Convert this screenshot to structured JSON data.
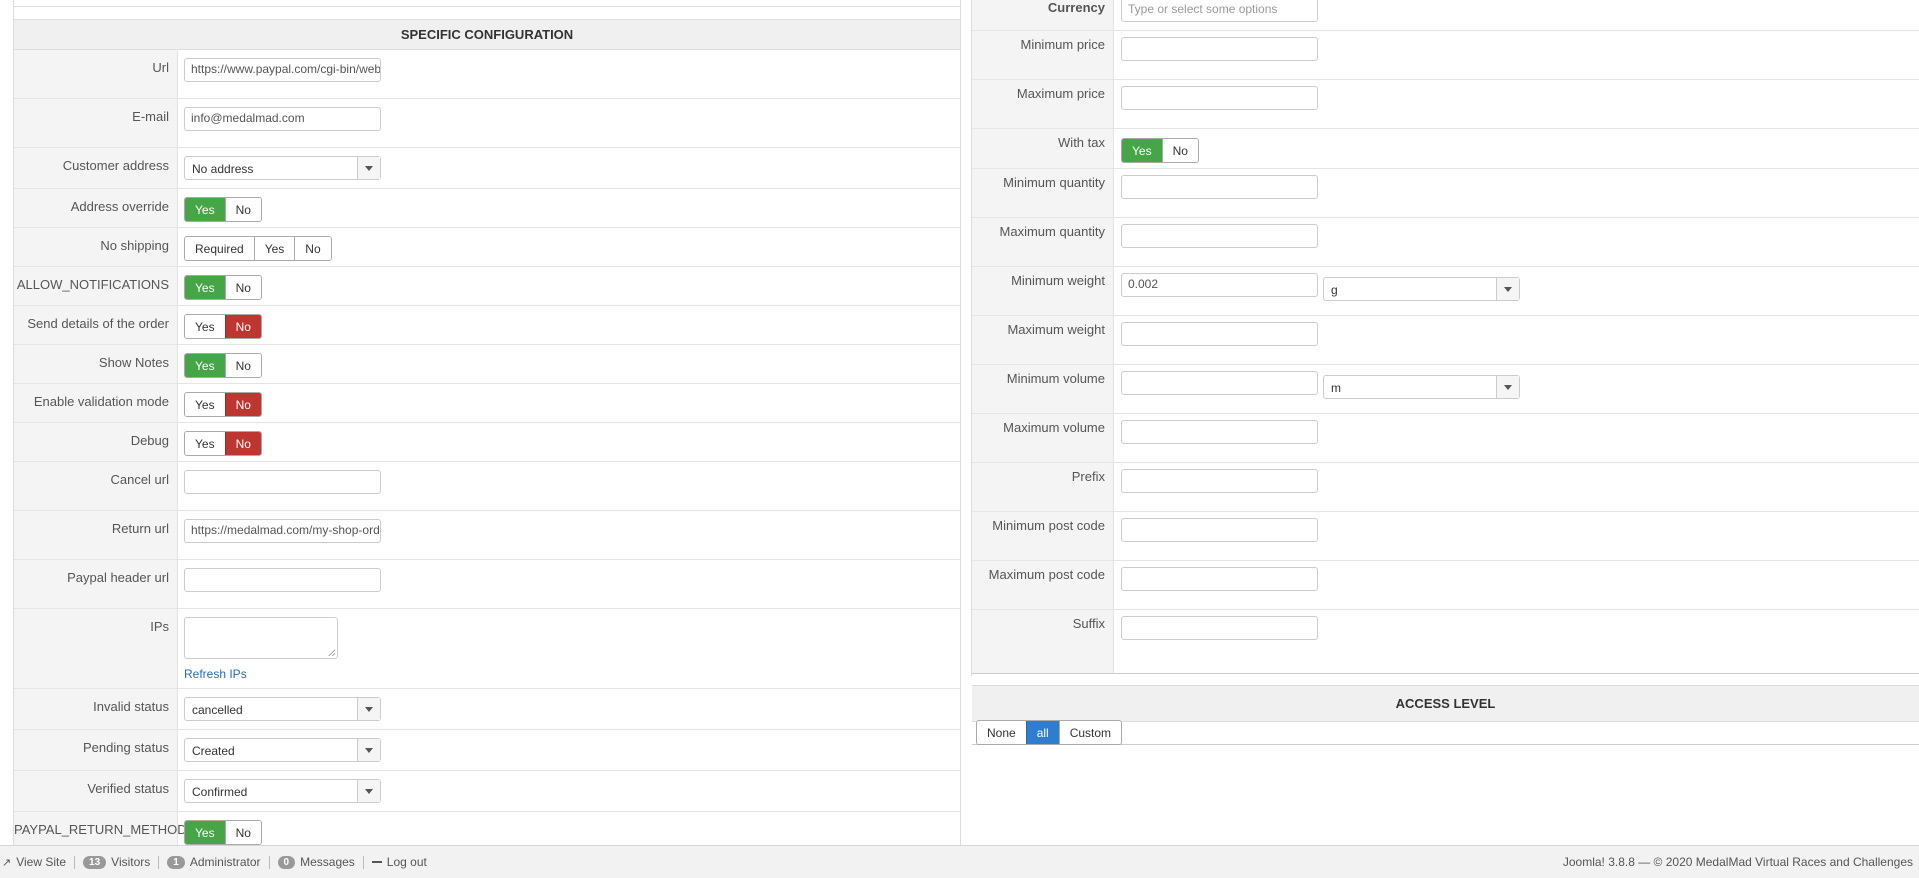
{
  "specific_configuration": {
    "title": "SPECIFIC CONFIGURATION",
    "url_label": "Url",
    "url_value": "https://www.paypal.com/cgi-bin/webscr",
    "email_label": "E-mail",
    "email_value": "info@medalmad.com",
    "customer_address_label": "Customer address",
    "customer_address_value": "No address",
    "address_override_label": "Address override",
    "no_shipping_label": "No shipping",
    "allow_notifications_label": "ALLOW_NOTIFICATIONS",
    "send_details_label": "Send details of the order",
    "show_notes_label": "Show Notes",
    "enable_validation_label": "Enable validation mode",
    "debug_label": "Debug",
    "cancel_url_label": "Cancel url",
    "cancel_url_value": "",
    "return_url_label": "Return url",
    "return_url_value": "https://medalmad.com/my-shop-order-complete",
    "header_url_label": "Paypal header url",
    "header_url_value": "",
    "ips_label": "IPs",
    "refresh_ips": "Refresh IPs",
    "invalid_status_label": "Invalid status",
    "invalid_status_value": "cancelled",
    "pending_status_label": "Pending status",
    "pending_status_value": "Created",
    "verified_status_label": "Verified status",
    "verified_status_value": "Confirmed",
    "return_method_label": "PAYPAL_RETURN_METHOD"
  },
  "buttons": {
    "yes": "Yes",
    "no": "No",
    "required": "Required"
  },
  "restrictions": {
    "currency_label": "Currency",
    "currency_placeholder": "Type or select some options",
    "min_price_label": "Minimum price",
    "max_price_label": "Maximum price",
    "with_tax_label": "With tax",
    "min_qty_label": "Minimum quantity",
    "max_qty_label": "Maximum quantity",
    "min_weight_label": "Minimum weight",
    "min_weight_value": "0.002",
    "weight_unit": "g",
    "max_weight_label": "Maximum weight",
    "min_volume_label": "Minimum volume",
    "volume_unit": "m",
    "max_volume_label": "Maximum volume",
    "prefix_label": "Prefix",
    "min_postcode_label": "Minimum post code",
    "max_postcode_label": "Maximum post code",
    "suffix_label": "Suffix"
  },
  "access_level": {
    "title": "ACCESS LEVEL",
    "none": "None",
    "all": "all",
    "custom": "Custom"
  },
  "footer": {
    "view_site": "View Site",
    "visitors_count": "13",
    "visitors": "Visitors",
    "admin_count": "1",
    "administrator": "Administrator",
    "messages_count": "0",
    "messages": "Messages",
    "logout": "Log out",
    "copyright": "Joomla! 3.8.8  —  © 2020 MedalMad Virtual Races and Challenges"
  },
  "colors": {
    "yes_active": "#46a546",
    "no_active": "#bd362f",
    "all_active": "#2f7dd1"
  }
}
